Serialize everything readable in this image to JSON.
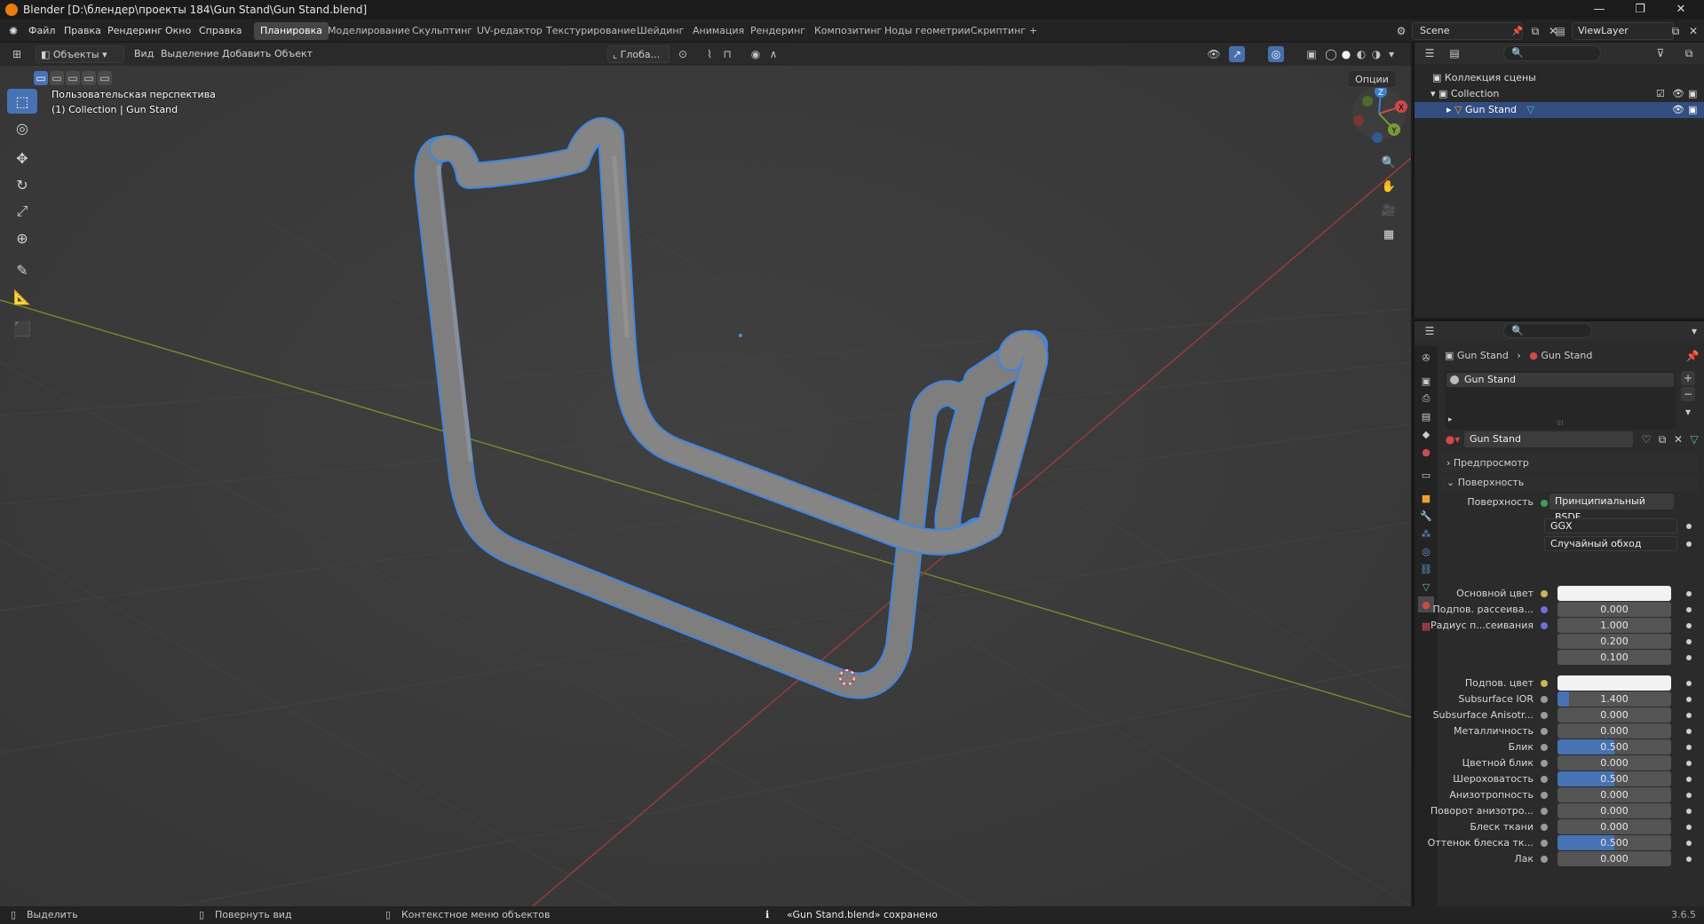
{
  "window": {
    "title": "Blender [D:\\блендер\\проекты 184\\Gun Stand\\Gun Stand.blend]",
    "minimize": "—",
    "maximize": "❐",
    "close": "✕"
  },
  "menus": [
    "Файл",
    "Правка",
    "Рендеринг",
    "Окно",
    "Справка"
  ],
  "workspaces": [
    "Планировка",
    "Моделирование",
    "Скульптинг",
    "UV-редактор",
    "Текстурирование",
    "Шейдинг",
    "Анимация",
    "Рендеринг",
    "Композитинг",
    "Ноды геометрии",
    "Скриптинг",
    "+"
  ],
  "active_workspace": "Планировка",
  "scene": "Scene",
  "view_layer": "ViewLayer",
  "viewport": {
    "mode": "Объекты",
    "menus": [
      "Вид",
      "Выделение",
      "Добавить",
      "Объект"
    ],
    "transform_orientation": "Глоба...",
    "options": "Опции",
    "perspective_label": "Пользовательская перспектива",
    "collection_label": "(1) Collection | Gun Stand",
    "gizmo_axes": [
      "X",
      "Y",
      "Z"
    ],
    "axis_colors": {
      "x": "#c94a4a",
      "y": "#7a9a3a",
      "z": "#3f7fcf"
    },
    "selection_outline": "#3f86e0"
  },
  "outliner": {
    "root": "Коллекция сцены",
    "collection": "Collection",
    "object": "Gun Stand"
  },
  "properties": {
    "breadcrumb_object": "Gun Stand",
    "breadcrumb_material": "Gun Stand",
    "material_slot": "Gun Stand",
    "material_name": "Gun Stand",
    "panel_preview": "Предпросмотр",
    "panel_surface": "Поверхность",
    "surface_label": "Поверхность",
    "surface_shader": "Принципиальный BSDF",
    "distribution": "GGX",
    "subsurface_method": "Случайный обход",
    "rows": [
      {
        "label": "Основной цвет",
        "type": "color",
        "value": "",
        "color": "#f2f2f2",
        "dot": "#c8b45a"
      },
      {
        "label": "Подпов. рассеива...",
        "type": "num",
        "value": "0.000",
        "fill": 0,
        "dot": "#6f6fcf"
      },
      {
        "label": "Радиус п...сеивания",
        "type": "num",
        "value": "1.000",
        "fill": 0,
        "dot": "#6f6fcf"
      },
      {
        "label": "",
        "type": "num",
        "value": "0.200",
        "fill": 0,
        "dot": ""
      },
      {
        "label": "",
        "type": "num",
        "value": "0.100",
        "fill": 0,
        "dot": ""
      },
      {
        "label": "Подпов. цвет",
        "type": "color",
        "value": "",
        "color": "#f2f2f2",
        "dot": "#c8b45a"
      },
      {
        "label": "Subsurface IOR",
        "type": "num",
        "value": "1.400",
        "fill": 0.1,
        "dot": "#9a9a9a"
      },
      {
        "label": "Subsurface Anisotr...",
        "type": "num",
        "value": "0.000",
        "fill": 0,
        "dot": "#9a9a9a"
      },
      {
        "label": "Металличность",
        "type": "num",
        "value": "0.000",
        "fill": 0,
        "dot": "#9a9a9a"
      },
      {
        "label": "Блик",
        "type": "num",
        "value": "0.500",
        "fill": 0.5,
        "dot": "#9a9a9a"
      },
      {
        "label": "Цветной блик",
        "type": "num",
        "value": "0.000",
        "fill": 0,
        "dot": "#9a9a9a"
      },
      {
        "label": "Шероховатость",
        "type": "num",
        "value": "0.500",
        "fill": 0.5,
        "dot": "#9a9a9a"
      },
      {
        "label": "Анизотропность",
        "type": "num",
        "value": "0.000",
        "fill": 0,
        "dot": "#9a9a9a"
      },
      {
        "label": "Поворот анизотро...",
        "type": "num",
        "value": "0.000",
        "fill": 0,
        "dot": "#9a9a9a"
      },
      {
        "label": "Блеск ткани",
        "type": "num",
        "value": "0.000",
        "fill": 0,
        "dot": "#9a9a9a"
      },
      {
        "label": "Оттенок блеска тк...",
        "type": "num",
        "value": "0.500",
        "fill": 0.5,
        "dot": "#9a9a9a"
      },
      {
        "label": "Лак",
        "type": "num",
        "value": "0.000",
        "fill": 0,
        "dot": "#9a9a9a"
      }
    ]
  },
  "statusbar": {
    "select": "Выделить",
    "rotate": "Повернуть вид",
    "context": "Контекстное меню объектов",
    "message": "«Gun Stand.blend» сохранено",
    "version": "3.6.5"
  }
}
